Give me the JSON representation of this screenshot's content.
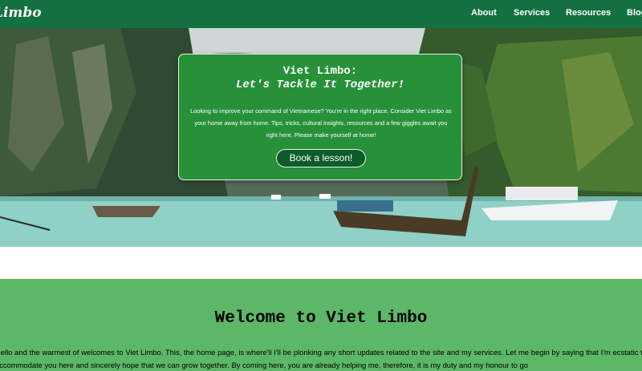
{
  "nav": {
    "logo": "Limbo",
    "links": [
      "About",
      "Services",
      "Resources",
      "Blog"
    ]
  },
  "hero": {
    "title": "Viet Limbo:",
    "tagline": "Let's Tackle It Together!",
    "text": "Looking to improve your command of Vietnamese? You're in the right place. Consider Viet Limbo as your home away from home. Tips, tricks, cultural insights, resources and a few giggles await you right here. Please make yourself at home!",
    "button_label": "Book a lesson!"
  },
  "welcome": {
    "heading": "Welcome to Viet Limbo",
    "text": "Hello and the warmest of welcomes to Viet Limbo. This, the home page, is where'll I'll be plonking any short updates related to the site and my services. Let me begin by saying that I'm ecstatic to accommodate you here and sincerely hope that we can grow together. By coming here, you are already helping me, therefore, it is my duty and my honour to go"
  },
  "colors": {
    "navbar": "#137040",
    "hero_card": "#27913a",
    "button": "#0d5a2d",
    "welcome_bg": "#5cb868",
    "water": "#8fd1c6"
  }
}
